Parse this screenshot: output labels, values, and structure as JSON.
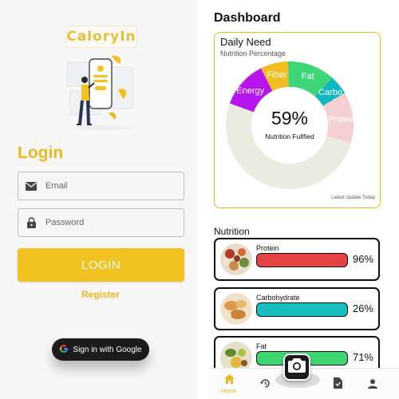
{
  "login": {
    "logo_text": "CaloryIn",
    "title": "Login",
    "email_placeholder": "Email",
    "password_placeholder": "Password",
    "login_label": "LOGIN",
    "register_label": "Register",
    "google_label": "Sign in with Google",
    "accent": "#f0c321"
  },
  "dashboard": {
    "title": "Dashboard",
    "daily_need": {
      "title": "Daily Need",
      "subtitle": "Nutrition Percentage",
      "percent": "59%",
      "center_label": "Nutrition Fullfied",
      "footer": "Latest Update Today"
    },
    "chart_data": {
      "type": "pie",
      "categories": [
        "Energy",
        "Fiber",
        "Fat",
        "Carbo",
        "Protein",
        "Remaining"
      ],
      "values": [
        12,
        7,
        12,
        5,
        13,
        51
      ],
      "colors": [
        "#b715f0",
        "#f2bd1e",
        "#3fd67a",
        "#12b8bf",
        "#f6cfd1",
        "#ebece0"
      ],
      "slice_labels": [
        "Energy",
        "Fiber",
        "Fat",
        "Carbo",
        "Protein",
        ""
      ],
      "donut": true
    },
    "nutrition": {
      "title": "Nutrition",
      "items": [
        {
          "name": "Protein",
          "percent": "96%",
          "color": "#e44343"
        },
        {
          "name": "Carbohydrate",
          "percent": "26%",
          "color": "#17bfbf"
        },
        {
          "name": "Fat",
          "percent": "71%",
          "color": "#3ed673"
        }
      ]
    },
    "nav": {
      "home_label": "Home",
      "items": [
        "home-icon",
        "history-icon",
        "camera-icon",
        "document-icon",
        "profile-icon"
      ]
    }
  }
}
